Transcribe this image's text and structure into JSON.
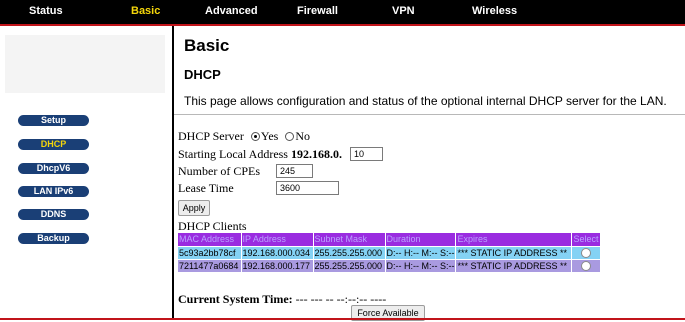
{
  "nav": {
    "tabs": [
      "Status",
      "Basic",
      "Advanced",
      "Firewall",
      "VPN",
      "Wireless"
    ],
    "active": "Basic"
  },
  "sidebar": {
    "buttons": [
      "Setup",
      "DHCP",
      "DhcpV6",
      "LAN IPv6",
      "DDNS",
      "Backup"
    ],
    "active": "DHCP"
  },
  "page": {
    "title": "Basic",
    "subtitle": "DHCP",
    "description": "This page allows configuration and status of the optional internal DHCP server for the LAN."
  },
  "form": {
    "dhcp_server_label": "DHCP Server",
    "yes_label": "Yes",
    "no_label": "No",
    "dhcp_server_value": "Yes",
    "start_addr_label": "Starting Local Address",
    "start_addr_prefix": "192.168.0.",
    "start_addr_value": "10",
    "cpes_label": "Number of CPEs",
    "cpes_value": "245",
    "lease_label": "Lease Time",
    "lease_value": "3600",
    "apply_label": "Apply"
  },
  "clients": {
    "heading": "DHCP Clients",
    "columns": [
      "MAC Address",
      "IP Address",
      "Subnet Mask",
      "Duration",
      "Expires",
      "Select"
    ],
    "rows": [
      [
        "5c93a2bb78cf",
        "192.168.000.034",
        "255.255.255.000",
        "D:-- H:-- M:-- S:--",
        "*** STATIC IP ADDRESS **",
        ""
      ],
      [
        "7211477a0684",
        "192.168.000.177",
        "255.255.255.000",
        "D:-- H:-- M:-- S:--",
        "*** STATIC IP ADDRESS **",
        ""
      ]
    ]
  },
  "system_time": {
    "label": "Current System Time:",
    "value": "--- --- -- --:--:-- ----"
  },
  "force_available_label": "Force Available",
  "colors": {
    "nav_bg": "#000000",
    "accent_red": "#c1141a",
    "active_yellow": "#f5d60a",
    "sidebar_button": "#1a3f76",
    "table_header": "#9a2ce0",
    "row_a": "#84d2f4",
    "row_b": "#a99ae0"
  }
}
